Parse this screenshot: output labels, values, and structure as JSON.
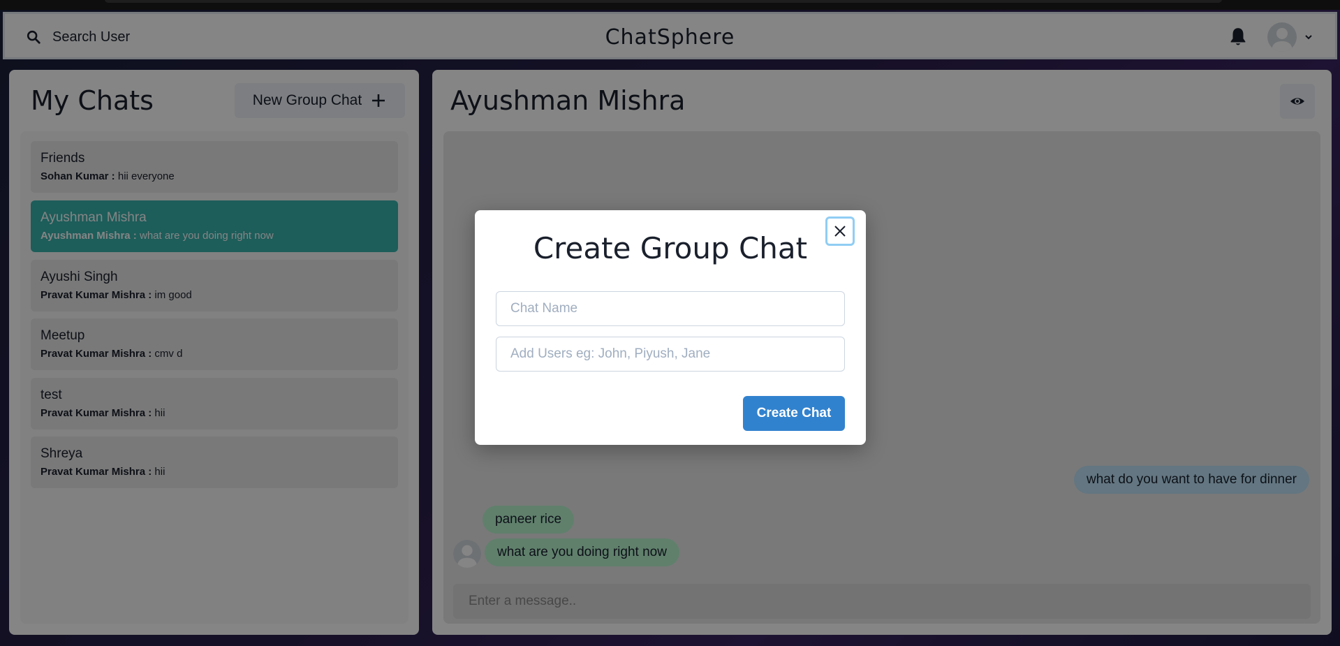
{
  "header": {
    "search_label": "Search User",
    "brand": "ChatSphere"
  },
  "sidebar": {
    "title": "My Chats",
    "new_group_label": "New Group Chat",
    "chats": [
      {
        "name": "Friends",
        "sender": "Sohan Kumar :",
        "message": "hii everyone",
        "active": false
      },
      {
        "name": "Ayushman Mishra",
        "sender": "Ayushman Mishra :",
        "message": "what are you doing right now",
        "active": true
      },
      {
        "name": "Ayushi Singh",
        "sender": "Pravat Kumar Mishra :",
        "message": "im good",
        "active": false
      },
      {
        "name": "Meetup",
        "sender": "Pravat Kumar Mishra :",
        "message": "cmv d",
        "active": false
      },
      {
        "name": "test",
        "sender": "Pravat Kumar Mishra :",
        "message": "hii",
        "active": false
      },
      {
        "name": "Shreya",
        "sender": "Pravat Kumar Mishra :",
        "message": "hii",
        "active": false
      }
    ]
  },
  "conversation": {
    "title": "Ayushman Mishra",
    "messages": [
      {
        "text": "what do you want to have for dinner",
        "direction": "sent"
      },
      {
        "text": "paneer rice",
        "direction": "received"
      },
      {
        "text": "what are you doing right now",
        "direction": "received"
      }
    ],
    "input_placeholder": "Enter a message.."
  },
  "modal": {
    "title": "Create Group Chat",
    "chat_name_placeholder": "Chat Name",
    "add_users_placeholder": "Add Users eg: John, Piyush, Jane",
    "create_label": "Create Chat"
  },
  "colors": {
    "active_chat": "#38b2ac",
    "sent_bubble": "#bee3f8",
    "received_bubble": "#b9f5d0",
    "primary_button": "#3182ce"
  }
}
